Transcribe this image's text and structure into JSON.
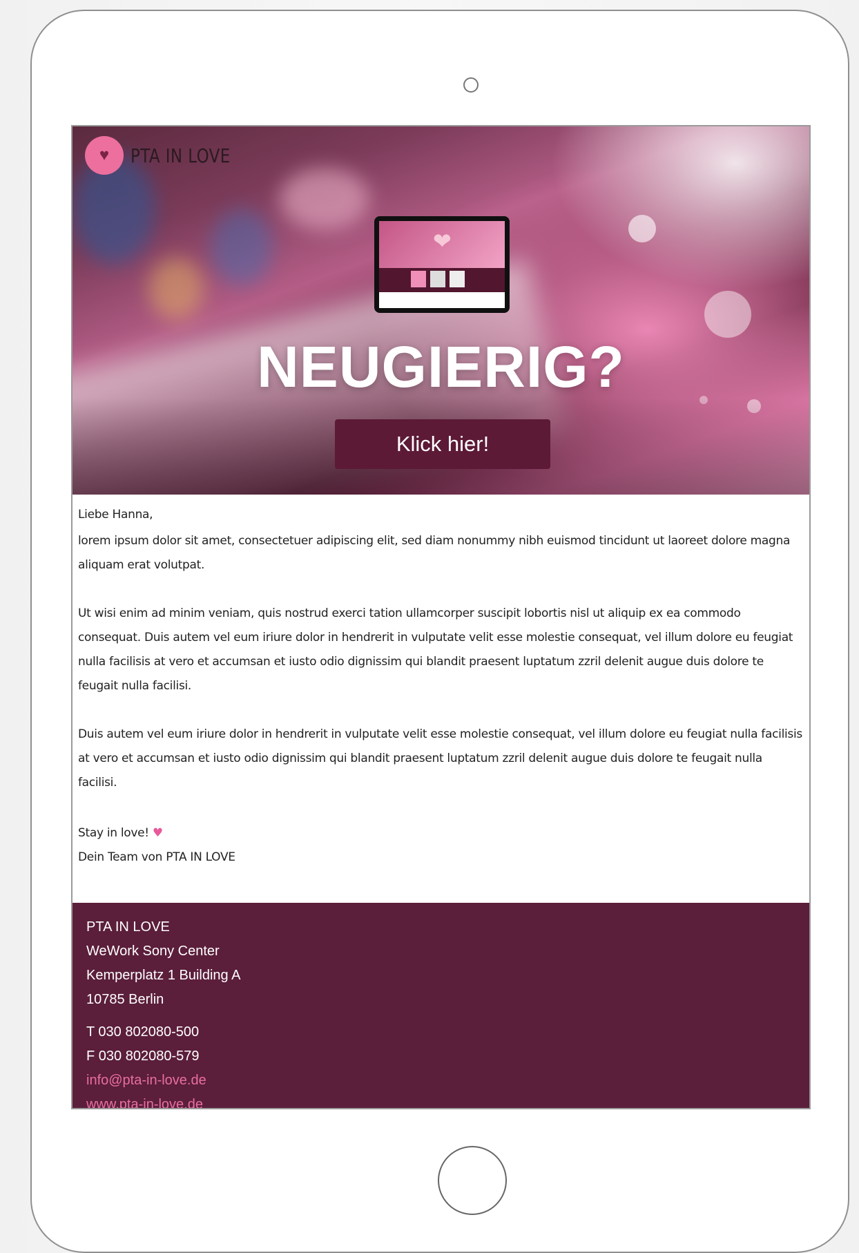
{
  "header": {
    "logo_text": "PTA IN LOVE",
    "logo_icon": "heart-icon"
  },
  "hero": {
    "headline": "NEUGIERIG?",
    "cta_label": "Klick hier!"
  },
  "body": {
    "greeting": "Liebe Hanna,",
    "paragraphs": [
      "lorem ipsum dolor sit amet, consectetuer adipiscing elit, sed diam nonummy nibh euismod tincidunt ut laoreet dolore magna aliquam erat volutpat.",
      "Ut wisi enim ad minim veniam, quis nostrud exerci tation ullamcorper suscipit lobortis nisl ut aliquip ex ea commodo consequat. Duis autem vel eum iriure dolor in hendrerit in vulputate velit esse molestie consequat, vel illum dolore eu feugiat nulla facilisis at vero et accumsan et iusto odio dignissim qui blandit praesent luptatum zzril delenit augue duis dolore te feugait nulla facilisi.",
      "Duis autem vel eum iriure dolor in hendrerit in vulputate velit esse molestie consequat, vel illum dolore eu feugiat nulla facilisis at vero et accumsan et iusto odio dignissim qui blandit praesent luptatum zzril delenit augue duis dolore te feugait nulla facilisi."
    ],
    "signoff": "Stay in love!",
    "signoff_icon": "two-hearts-icon",
    "signature": "Dein Team von PTA IN LOVE"
  },
  "footer": {
    "company": "PTA IN LOVE",
    "address_line1": "WeWork Sony Center",
    "address_line2": "Kemperplatz 1 Building A",
    "address_line3": "10785 Berlin",
    "phone": "T 030 802080-500",
    "fax": "F 030 802080-579",
    "email": "info@pta-in-love.de",
    "website": "www.pta-in-love.de"
  },
  "colors": {
    "brand_dark": "#5b1e3b",
    "brand_pink": "#e86fa1",
    "button": "#5c1a36"
  }
}
